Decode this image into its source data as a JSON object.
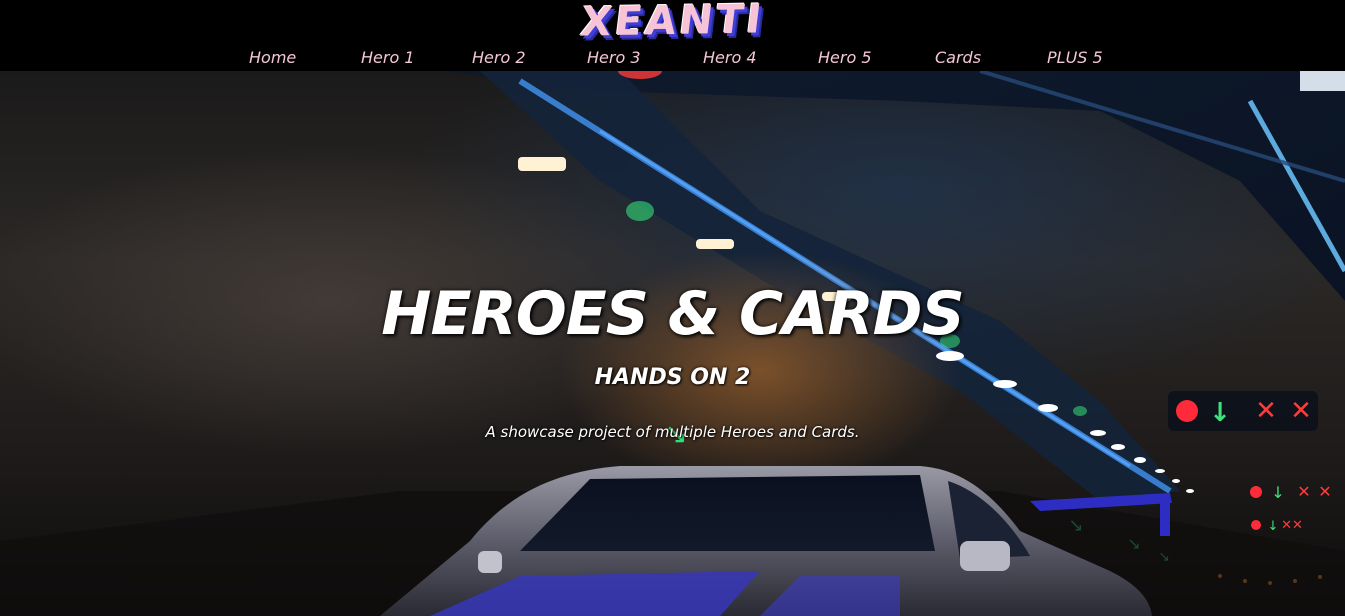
{
  "header": {
    "logo_text": "XEANTI"
  },
  "nav": {
    "items": [
      {
        "label": "Home"
      },
      {
        "label": "Hero 1"
      },
      {
        "label": "Hero 2"
      },
      {
        "label": "Hero 3"
      },
      {
        "label": "Hero 4"
      },
      {
        "label": "Hero 5"
      },
      {
        "label": "Cards"
      },
      {
        "label": "PLUS 5"
      }
    ]
  },
  "hero": {
    "title": "HEROES & CARDS",
    "subtitle": "HANDS ON 2",
    "description": "A showcase project of multiple Heroes and Cards."
  },
  "colors": {
    "header_bg": "#000000",
    "nav_text": "#f3c7d6",
    "logo_fill": "#f7c3d6",
    "logo_shadow": "#3f3fd8",
    "hero_text": "#ffffff"
  }
}
